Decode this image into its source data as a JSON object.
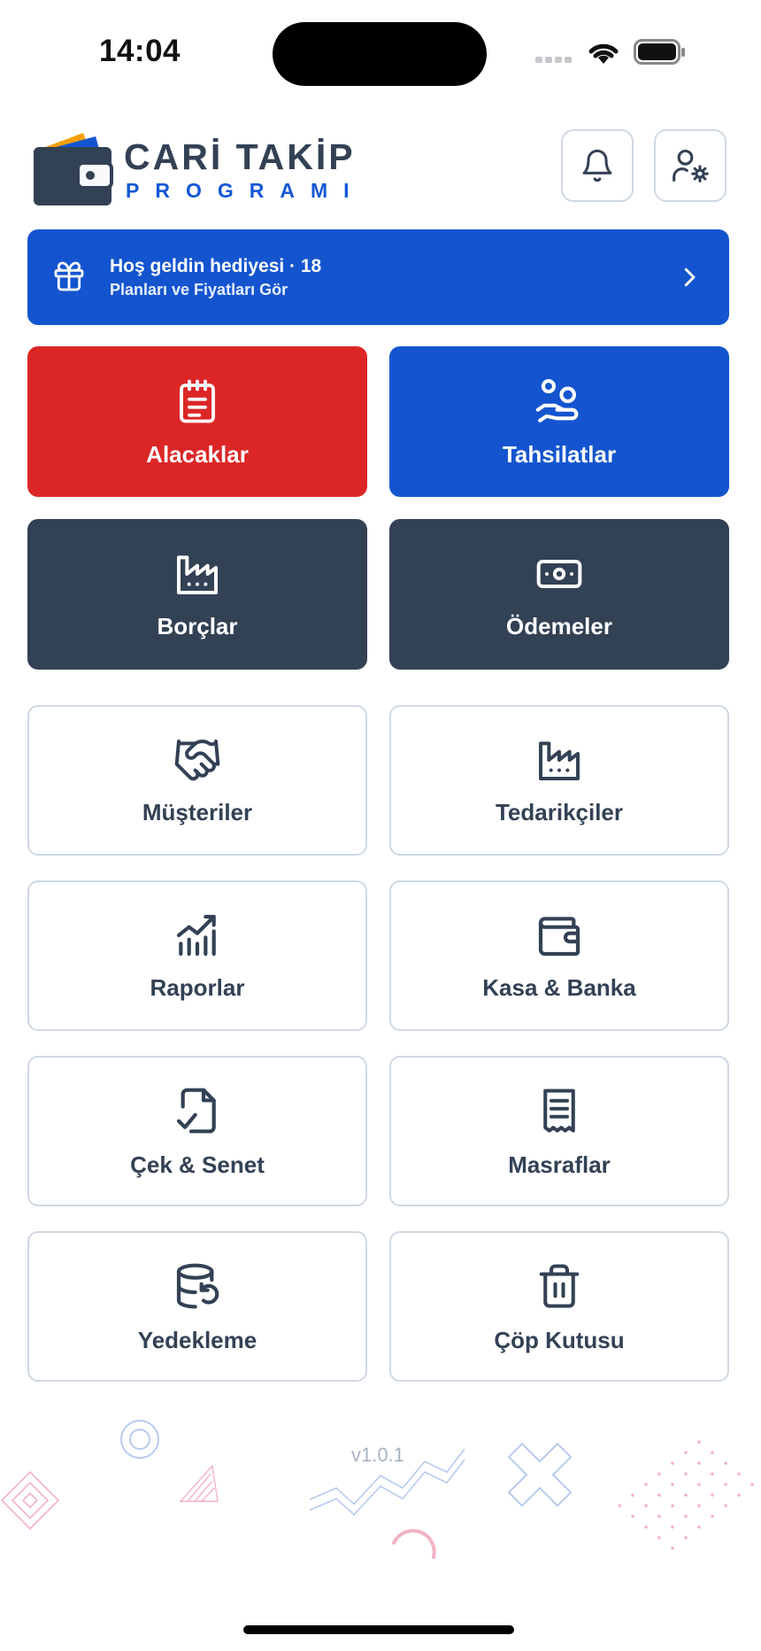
{
  "status_bar": {
    "time": "14:04"
  },
  "header": {
    "brand_line1": "CARİ TAKİP",
    "brand_line2": "PROGRAMI",
    "icons": [
      "bell-icon",
      "user-settings-icon"
    ]
  },
  "banner": {
    "title": "Hoş geldin hediyesi · 18",
    "subtitle": "Planları ve Fiyatları Gör",
    "color": "#1455cf"
  },
  "primary_tiles": [
    {
      "label": "Alacaklar",
      "icon": "notepad-icon",
      "color": "#dc2626"
    },
    {
      "label": "Tahsilatlar",
      "icon": "hand-receive-icon",
      "color": "#1455cf"
    },
    {
      "label": "Borçlar",
      "icon": "factory-icon",
      "color": "#334155"
    },
    {
      "label": "Ödemeler",
      "icon": "banknote-icon",
      "color": "#334155"
    }
  ],
  "menu_tiles": [
    {
      "label": "Müşteriler",
      "icon": "handshake-icon"
    },
    {
      "label": "Tedarikçiler",
      "icon": "factory-icon"
    },
    {
      "label": "Raporlar",
      "icon": "chart-trend-icon"
    },
    {
      "label": "Kasa & Banka",
      "icon": "wallet-icon"
    },
    {
      "label": "Çek & Senet",
      "icon": "file-check-icon"
    },
    {
      "label": "Masraflar",
      "icon": "receipt-icon"
    },
    {
      "label": "Yedekleme",
      "icon": "database-restore-icon"
    },
    {
      "label": "Çöp Kutusu",
      "icon": "trash-icon"
    }
  ],
  "footer": {
    "version": "v1.0.1"
  }
}
